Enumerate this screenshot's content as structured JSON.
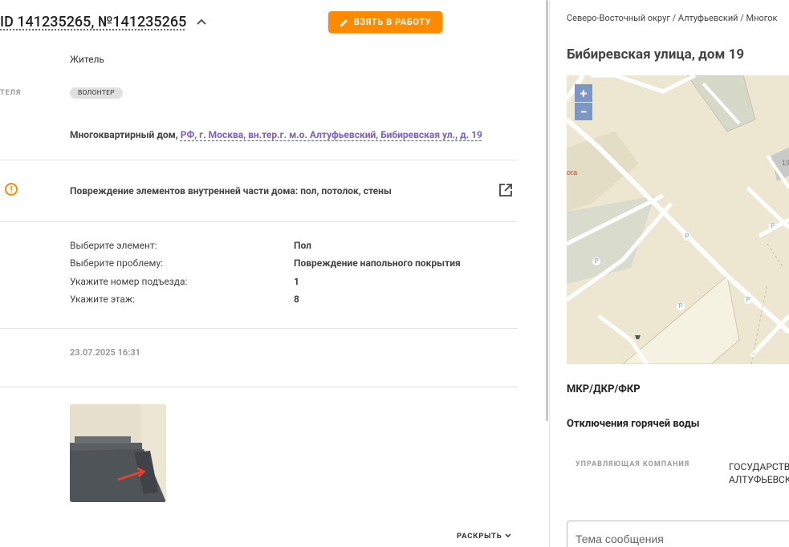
{
  "header": {
    "title": "ID 141235265, №141235265",
    "take_button": "ВЗЯТЬ В РАБОТУ"
  },
  "applicant": {
    "role": "Житель",
    "cut_label": "ТЕЛЯ",
    "badge": "ВОЛОНТЕР"
  },
  "address": {
    "type": "Многоквартирный дом,",
    "link": "РФ, г. Москва, вн.тер.г. м.о. Алтуфьевский, Бибиревская ул., д. 19"
  },
  "category": "Повреждение элементов внутренней части дома: пол, потолок, стены",
  "details": [
    {
      "label": "Выберите элемент:",
      "value": "Пол"
    },
    {
      "label": "Выберите проблему:",
      "value": "Повреждение напольного покрытия"
    },
    {
      "label": "Укажите номер подъезда:",
      "value": "1"
    },
    {
      "label": "Укажите этаж:",
      "value": "8"
    }
  ],
  "timestamp": "23.07.2025 16:31",
  "expand_label": "РАСКРЫТЬ",
  "right": {
    "breadcrumbs": "Северо-Восточный округ / Алтуфьевский / Многок",
    "address_title": "Бибиревская улица, дом 19",
    "map": {
      "zoom_in": "+",
      "zoom_out": "−",
      "building_label": "19",
      "place_label": "ога",
      "parking": "P"
    },
    "section1": "МКР/ДКР/ФКР",
    "section2": "Отключения горячей воды",
    "management_label": "УПРАВЛЯЮЩАЯ КОМПАНИЯ",
    "management_value_line1": "ГОСУДАРСТВ",
    "management_value_line2": "АЛТУФЬЕВСК",
    "subject_placeholder": "Тема сообщения"
  },
  "colors": {
    "accent": "#ff8a00",
    "link": "#7b61c8",
    "map_zoom": "#7d97c4"
  }
}
